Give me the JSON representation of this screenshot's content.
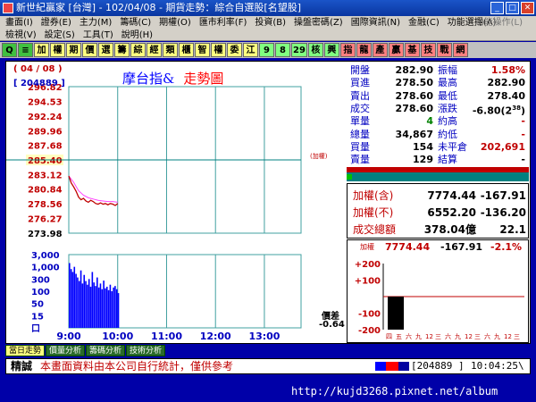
{
  "window": {
    "title": "新世紀贏家 [台灣] - 102/04/08 - 期貨走勢：綜合自選股[名望股]"
  },
  "menus": {
    "row1": [
      "畫面(I)",
      "證券(E)",
      "主力(M)",
      "籌碼(C)",
      "期權(O)",
      "匯市利率(F)",
      "投資(B)",
      "操盤密碼(Z)",
      "國際資訊(N)",
      "金融(C)",
      "功能選擇(A)"
    ],
    "row1_right": "功能操作(L)",
    "row2": [
      "檢視(V)",
      "設定(S)",
      "工具(T)",
      "說明(H)"
    ]
  },
  "toolbar": {
    "items": [
      {
        "label": "Q",
        "bg": "#40c040"
      },
      {
        "label": "≡",
        "bg": "#40c040"
      },
      {
        "label": "加",
        "bg": "#ffff80"
      },
      {
        "label": "權",
        "bg": "#ffff80"
      },
      {
        "label": "期",
        "bg": "#ffff80"
      },
      {
        "label": "價",
        "bg": "#ffff80"
      },
      {
        "label": "選",
        "bg": "#ffff80"
      },
      {
        "label": "籌",
        "bg": "#ffff80"
      },
      {
        "label": "綜",
        "bg": "#ffff80"
      },
      {
        "label": "經",
        "bg": "#ffff80"
      },
      {
        "label": "類",
        "bg": "#ffff80"
      },
      {
        "label": "櫃",
        "bg": "#ffff80"
      },
      {
        "label": "智",
        "bg": "#ffff80"
      },
      {
        "label": "權",
        "bg": "#ffff80"
      },
      {
        "label": "委",
        "bg": "#ffff80"
      },
      {
        "label": "江",
        "bg": "#ffff80"
      },
      {
        "label": "9",
        "bg": "#80ff80"
      },
      {
        "label": "8",
        "bg": "#80ff80"
      },
      {
        "label": "29",
        "bg": "#80ff80"
      },
      {
        "label": "核",
        "bg": "#80ff80"
      },
      {
        "label": "興",
        "bg": "#80ff80"
      },
      {
        "label": "指",
        "bg": "#ff8080"
      },
      {
        "label": "龍",
        "bg": "#ff8080"
      },
      {
        "label": "產",
        "bg": "#ff8080"
      },
      {
        "label": "贏",
        "bg": "#ff8080"
      },
      {
        "label": "基",
        "bg": "#ff8080"
      },
      {
        "label": "技",
        "bg": "#ff8080"
      },
      {
        "label": "戰",
        "bg": "#ff8080"
      },
      {
        "label": "網",
        "bg": "#ff8080"
      }
    ]
  },
  "chart_header": {
    "date": "( 04 / 08 )",
    "code": "[ 204889 ]",
    "name": "摩台指&",
    "subtitle": "走勢圖"
  },
  "chart_data": {
    "type": "line",
    "y_ticks": [
      "296.82",
      "294.53",
      "292.24",
      "289.96",
      "287.68",
      "285.40",
      "283.12",
      "280.84",
      "278.56",
      "276.27",
      "273.98"
    ],
    "y_range": [
      273.98,
      296.82
    ],
    "ref_price": 285.4,
    "ref_label": "(加權)",
    "x_ticks": [
      "9:00",
      "10:00",
      "11:00",
      "12:00",
      "13:00"
    ],
    "price_series": [
      {
        "t": "09:00",
        "v": 282.9
      },
      {
        "t": "09:03",
        "v": 281.8
      },
      {
        "t": "09:06",
        "v": 281.2
      },
      {
        "t": "09:09",
        "v": 280.5
      },
      {
        "t": "09:12",
        "v": 279.6
      },
      {
        "t": "09:15",
        "v": 279.2
      },
      {
        "t": "09:18",
        "v": 279.4
      },
      {
        "t": "09:21",
        "v": 279.0
      },
      {
        "t": "09:24",
        "v": 278.8
      },
      {
        "t": "09:27",
        "v": 279.1
      },
      {
        "t": "09:30",
        "v": 278.9
      },
      {
        "t": "09:33",
        "v": 278.6
      },
      {
        "t": "09:36",
        "v": 278.5
      },
      {
        "t": "09:39",
        "v": 278.7
      },
      {
        "t": "09:42",
        "v": 278.5
      },
      {
        "t": "09:45",
        "v": 278.6
      },
      {
        "t": "09:48",
        "v": 278.4
      },
      {
        "t": "09:51",
        "v": 278.6
      },
      {
        "t": "09:54",
        "v": 278.5
      },
      {
        "t": "09:57",
        "v": 278.3
      },
      {
        "t": "10:00",
        "v": 278.6
      }
    ],
    "avg_series": [
      {
        "t": "09:00",
        "v": 282.9
      },
      {
        "t": "09:06",
        "v": 281.9
      },
      {
        "t": "09:12",
        "v": 280.6
      },
      {
        "t": "09:18",
        "v": 279.9
      },
      {
        "t": "09:24",
        "v": 279.5
      },
      {
        "t": "09:30",
        "v": 279.3
      },
      {
        "t": "09:36",
        "v": 279.1
      },
      {
        "t": "09:42",
        "v": 279.0
      },
      {
        "t": "09:48",
        "v": 278.9
      },
      {
        "t": "09:54",
        "v": 278.9
      },
      {
        "t": "10:00",
        "v": 278.8
      }
    ],
    "volume_ticks": [
      "3,000",
      "1,000",
      "300",
      "100",
      "50",
      "15",
      "口"
    ],
    "volume_series": [
      {
        "t": "09:00",
        "v": 1400
      },
      {
        "t": "09:02",
        "v": 800
      },
      {
        "t": "09:04",
        "v": 600
      },
      {
        "t": "09:06",
        "v": 1000
      },
      {
        "t": "09:08",
        "v": 500
      },
      {
        "t": "09:10",
        "v": 350
      },
      {
        "t": "09:12",
        "v": 250
      },
      {
        "t": "09:14",
        "v": 700
      },
      {
        "t": "09:16",
        "v": 200
      },
      {
        "t": "09:18",
        "v": 450
      },
      {
        "t": "09:20",
        "v": 250
      },
      {
        "t": "09:22",
        "v": 180
      },
      {
        "t": "09:24",
        "v": 300
      },
      {
        "t": "09:26",
        "v": 150
      },
      {
        "t": "09:28",
        "v": 600
      },
      {
        "t": "09:30",
        "v": 220
      },
      {
        "t": "09:32",
        "v": 160
      },
      {
        "t": "09:34",
        "v": 350
      },
      {
        "t": "09:36",
        "v": 140
      },
      {
        "t": "09:38",
        "v": 200
      },
      {
        "t": "09:40",
        "v": 120
      },
      {
        "t": "09:42",
        "v": 260
      },
      {
        "t": "09:44",
        "v": 130
      },
      {
        "t": "09:46",
        "v": 150
      },
      {
        "t": "09:48",
        "v": 110
      },
      {
        "t": "09:50",
        "v": 180
      },
      {
        "t": "09:52",
        "v": 100
      },
      {
        "t": "09:54",
        "v": 140
      },
      {
        "t": "09:56",
        "v": 160
      },
      {
        "t": "09:58",
        "v": 120
      },
      {
        "t": "10:00",
        "v": 90
      }
    ],
    "price_diff_label": "價差",
    "price_diff": "-0.64"
  },
  "quote": {
    "rows": [
      {
        "l1": "開盤",
        "v1": "282.90",
        "l2": "振幅",
        "v2": "1.58%",
        "c2": "#c00000"
      },
      {
        "l1": "買進",
        "v1": "278.50",
        "l2": "最高",
        "v2": "282.90",
        "c2": "#000"
      },
      {
        "l1": "賣出",
        "v1": "278.60",
        "l2": "最低",
        "v2": "278.40",
        "c2": "#000"
      },
      {
        "l1": "成交",
        "v1": "278.60",
        "l2": "漲跌",
        "v2": "-6.80(2",
        "c2": "#000",
        "v2_sup": "38",
        "v2_tail": ")"
      },
      {
        "l1": "單量",
        "v1": "4",
        "l2": "約高",
        "v2": "-",
        "c2": "#c00000",
        "c1": "#008000"
      },
      {
        "l1": "總量",
        "v1": "34,867",
        "l2": "約低",
        "v2": "-",
        "c2": "#c00000"
      },
      {
        "l1": "買量",
        "v1": "154",
        "l2": "未平倉",
        "v2": "202,691",
        "c2": "#c00000"
      },
      {
        "l1": "賣量",
        "v1": "129",
        "l2": "結算",
        "v2": "-",
        "c2": "#000"
      }
    ],
    "index": [
      {
        "l": "加權(含)",
        "v1": "7774.44",
        "v2": "-167.91"
      },
      {
        "l": "加權(不)",
        "v1": "6552.20",
        "v2": "-136.20"
      },
      {
        "l": "成交總額",
        "v1": "378.04億",
        "v2": "22.1"
      }
    ]
  },
  "mini_chart": {
    "label": "加權",
    "value": "7774.44",
    "change": "-167.91",
    "pct": "-2.1%",
    "y_ticks": [
      "+200",
      "+100",
      "0",
      "-100",
      "-200"
    ],
    "x_labels": [
      "四",
      "五",
      "六",
      "九",
      "12",
      "三",
      "六",
      "九",
      "12",
      "三",
      "六",
      "九",
      "12",
      "三"
    ],
    "current_bar": -100
  },
  "tabs": [
    "當日走勢",
    "價量分析",
    "籌碼分析",
    "技術分析"
  ],
  "status": {
    "tag": "精誠",
    "message": "本畫面資料由本公司自行統計，僅供參考",
    "code": "[204889 ]",
    "time": "10:04:25\\"
  },
  "footer": {
    "url": "http://kujd3268.pixnet.net/album"
  }
}
